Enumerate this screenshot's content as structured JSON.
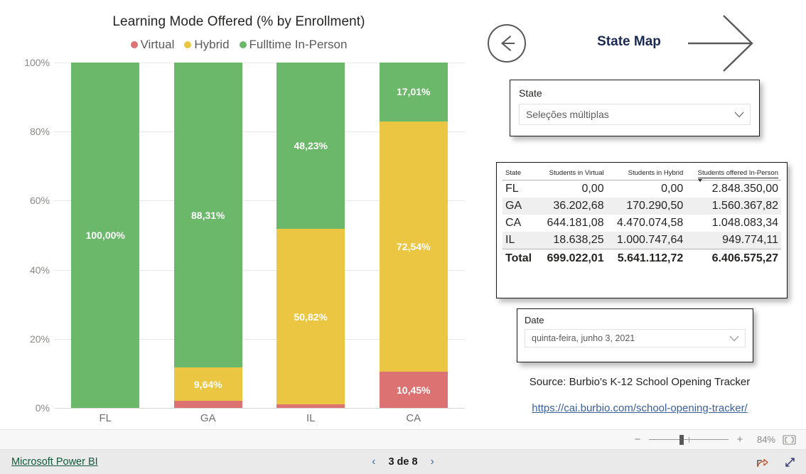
{
  "chart_data": {
    "type": "bar",
    "subtype": "stacked-100-percent",
    "title": "Learning Mode Offered (% by Enrollment)",
    "xlabel": "",
    "ylabel": "",
    "ylim": [
      0,
      100
    ],
    "ytick_labels": [
      "100%",
      "80%",
      "60%",
      "40%",
      "20%",
      "0%"
    ],
    "grid": true,
    "legend_position": "top",
    "categories": [
      "FL",
      "GA",
      "IL",
      "CA"
    ],
    "legend": [
      "Virtual",
      "Hybrid",
      "Fulltime In-Person"
    ],
    "colors": {
      "virtual": "#DD7272",
      "hybrid": "#EAC642",
      "in_person": "#6CB86A"
    },
    "series": [
      {
        "name": "Virtual",
        "color": "#DD7272",
        "values": [
          0,
          2.05,
          0.95,
          10.45
        ],
        "labels": [
          "",
          "",
          "",
          "10,45%"
        ]
      },
      {
        "name": "Hybrid",
        "color": "#EAC642",
        "values": [
          0,
          9.64,
          50.82,
          72.54
        ],
        "labels": [
          "",
          "9,64%",
          "50,82%",
          "72,54%"
        ]
      },
      {
        "name": "Fulltime In-Person",
        "color": "#6CB86A",
        "values": [
          100,
          88.31,
          48.23,
          17.01
        ],
        "labels": [
          "100,00%",
          "88,31%",
          "48,23%",
          "17,01%"
        ]
      }
    ]
  },
  "nav": {
    "back_icon": "circle-left-arrow-icon",
    "title": "State Map",
    "forward_icon": "right-arrow-icon"
  },
  "state_slicer": {
    "title": "State",
    "value": "Seleções múltiplas",
    "chevron_icon": "chevron-down-icon"
  },
  "date_slicer": {
    "title": "Date",
    "value": "quinta-feira, junho 3, 2021",
    "chevron_icon": "chevron-down-icon"
  },
  "table": {
    "columns": [
      "State",
      "Students in Virtual",
      "Students in Hybrid",
      "Students offered In-Person"
    ],
    "sorted_column": "Students offered In-Person",
    "sort_direction": "descending",
    "rows": [
      {
        "state": "FL",
        "virtual": "0,00",
        "hybrid": "0,00",
        "in_person": "2.848.350,00"
      },
      {
        "state": "GA",
        "virtual": "36.202,68",
        "hybrid": "170.290,50",
        "in_person": "1.560.367,82"
      },
      {
        "state": "CA",
        "virtual": "644.181,08",
        "hybrid": "4.470.074,58",
        "in_person": "1.048.083,34"
      },
      {
        "state": "IL",
        "virtual": "18.638,25",
        "hybrid": "1.000.747,64",
        "in_person": "949.774,11"
      }
    ],
    "total": {
      "state": "Total",
      "virtual": "699.022,01",
      "hybrid": "5.641.112,72",
      "in_person": "6.406.575,27"
    }
  },
  "source": {
    "text": "Source: Burbio's K-12 School Opening Tracker",
    "url_text": "https://cai.burbio.com/school-opening-tracker/"
  },
  "zoombar": {
    "minus": "−",
    "plus": "+",
    "percent": "84%",
    "fit_icon": "fit-to-page-icon"
  },
  "statusbar": {
    "brand": "Microsoft Power BI",
    "prev_icon": "‹",
    "page_label": "3 de 8",
    "next_icon": "›",
    "share_icon": "share-icon",
    "fullscreen_icon": "fullscreen-icon"
  }
}
